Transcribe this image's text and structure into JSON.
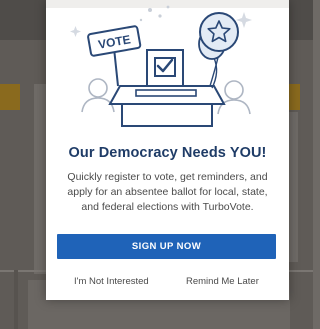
{
  "modal": {
    "title": "Our Democracy Needs YOU!",
    "body": "Quickly register to vote, get reminders, and apply for an absentee ballot for local, state, and federal elections with TurboVote.",
    "primary_button": "SIGN UP NOW",
    "decline_link": "I'm Not Interested",
    "remind_link": "Remind Me Later",
    "illustration": {
      "vote_sign_text": "VOTE",
      "icons": [
        "vote-sign-icon",
        "ballot-box-icon",
        "checkbox-ballot-icon",
        "star-balloon-icon",
        "person-icon",
        "sparkle-icon"
      ]
    }
  },
  "colors": {
    "title": "#1f3c67",
    "button": "#1f63b8",
    "illustration_line": "#2a4876",
    "balloon_fill": "#e3ebf5",
    "overlay": "#5f5b57"
  }
}
